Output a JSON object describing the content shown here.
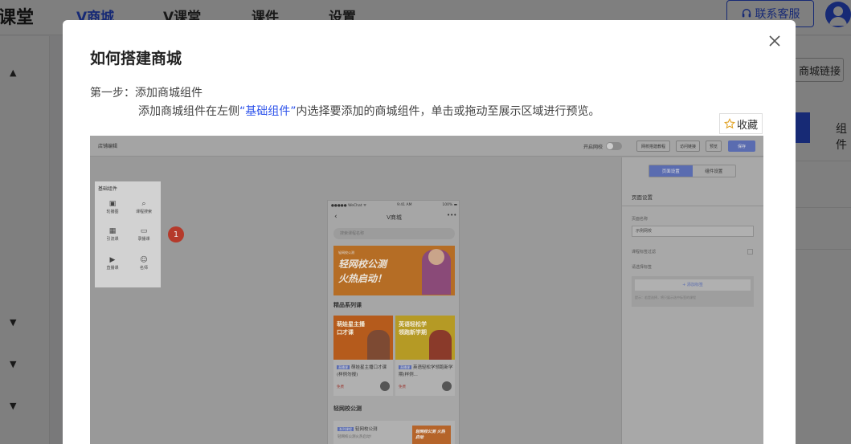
{
  "app": {
    "logo": "课堂",
    "nav": [
      "V商城",
      "V课堂",
      "课件",
      "设置"
    ],
    "active_nav": "V商城",
    "service_button": "联系客服",
    "link_button": "商城链接",
    "component_tab": "组件"
  },
  "modal": {
    "title": "如何搭建商城",
    "step_label": "第一步：添加商城组件",
    "step_desc_pre": "添加商城组件在左侧",
    "step_desc_highlight": "“基础组件”",
    "step_desc_post": "内选择要添加的商城组件，单击或拖动至展示区域进行预览。",
    "favorite_label": "收藏"
  },
  "screenshot": {
    "top_title": "店铺编辑",
    "toggle_label": "开启网校",
    "buttons": [
      "网校搭建教程",
      "访问链接",
      "预览",
      "保存"
    ],
    "components": {
      "header": "基础组件",
      "items": [
        {
          "icon": "image-icon",
          "label": "轮播图"
        },
        {
          "icon": "search-icon",
          "label": "课程搜索"
        },
        {
          "icon": "grid-icon",
          "label": "引流课"
        },
        {
          "icon": "video-icon",
          "label": "录播课"
        },
        {
          "icon": "live-icon",
          "label": "直播课"
        },
        {
          "icon": "teacher-icon",
          "label": "名师"
        }
      ]
    },
    "badge": "1",
    "phone": {
      "status_left": "●●●●● WeChat ᯤ",
      "status_time": "9:41 AM",
      "status_right": "100% ▬",
      "nav_title": "V商城",
      "search_placeholder": "搜索课程名称",
      "banner_tag": "轻网校公测",
      "banner_line1": "轻网校公测",
      "banner_line2": "火热启动！",
      "section1": "精品系列课",
      "cards": [
        {
          "img_text": "萌娃星主播\n口才课",
          "tag": "直播课",
          "title": "萌娃星主播口才课(样例勿报)",
          "price": "免费"
        },
        {
          "img_text": "英语轻松学\n领跑新学期",
          "tag": "直播课",
          "title": "英语轻松学领跑新学期(样例...",
          "price": "免费"
        }
      ],
      "section2": "轻网校公测",
      "course": {
        "tag": "系列课程",
        "title": "轻网校公测",
        "sub": "轻网校公测火热启动!",
        "img_text": "轻网校公测 火热启动"
      }
    },
    "settings": {
      "tabs": [
        "页面设置",
        "组件设置"
      ],
      "active_tab": "页面设置",
      "header": "页面设置",
      "name_label": "页面名称",
      "name_value": "示例网校",
      "filter_label": "课程标签过滤",
      "tag_label": "请选择标签",
      "add_tag": "+ 添加标签",
      "hint": "提示：若是选择，将只展示选中标签的课程"
    }
  }
}
